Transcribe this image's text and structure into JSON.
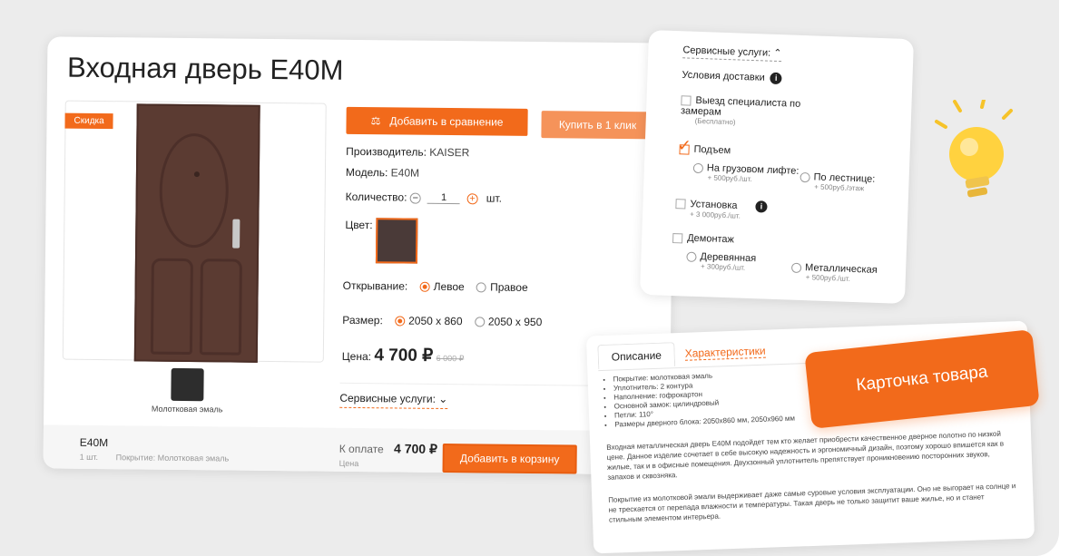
{
  "product": {
    "title": "Входная дверь E40M",
    "sale_badge": "Скидка",
    "swatch_label": "Молотковая эмаль",
    "compare_button": "Добавить в сравнение",
    "buy_one_click": "Купить в 1 клик",
    "manufacturer_label": "Производитель:",
    "manufacturer": "KAISER",
    "model_label": "Модель:",
    "model": "E40M",
    "quantity_label": "Количество:",
    "quantity_value": "1",
    "quantity_unit": "шт.",
    "color_label": "Цвет:",
    "opening_label": "Открывание:",
    "opening_options": [
      "Левое",
      "Правое"
    ],
    "size_label": "Размер:",
    "size_options": [
      "2050 x 860",
      "2050 x 950"
    ],
    "price_label": "Цена:",
    "price": "4 700 ₽",
    "old_price": "6 000 ₽",
    "services_toggle": "Сервисные услуги:"
  },
  "bottom_bar": {
    "model": "E40M",
    "qty": "1 шт.",
    "coating": "Покрытие: Молотковая эмаль",
    "to_pay_label": "К оплате",
    "total": "4 700 ₽",
    "price_caption": "Цена",
    "add_to_cart": "Добавить в корзину"
  },
  "services": {
    "header": "Сервисные услуги:",
    "delivery_label": "Условия доставки",
    "visit": {
      "label": "Выезд специалиста по замерам",
      "note": "(Бесплатно)"
    },
    "lift": {
      "label": "Подъем",
      "freight": "На грузовом лифте:",
      "freight_price": "+ 500руб./шт.",
      "stairs": "По лестнице:",
      "stairs_price": "+ 500руб./этаж"
    },
    "install": {
      "label": "Установка",
      "price": "+ 3 000руб./шт."
    },
    "dismantle": {
      "label": "Демонтаж",
      "wood": "Деревянная",
      "wood_price": "+ 300руб./шт.",
      "metal": "Металлическая",
      "metal_price": "+ 500руб./шт."
    }
  },
  "description": {
    "tab_description": "Описание",
    "tab_specs": "Характеристики",
    "bullets": [
      "Покрытие: молотковая эмаль",
      "Уплотнитель: 2 контура",
      "Наполнение: гофрокартон",
      "Основной замок: цилиндровый",
      "Петли: 110°",
      "Размеры дверного блока: 2050x860 мм, 2050x960 мм"
    ],
    "paragraph1": "Входная металлическая дверь E40M подойдет тем кто желает приобрести качественное дверное полотно по низкой цене. Данное изделие сочетает в себе высокую надежность и эргономичный дизайн, поэтому хорошо впишется как в жилые, так и в офисные помещения. Двухзонный уплотнитель препятствует проникновению посторонних звуков, запахов и сквозняка.",
    "paragraph2": "Покрытие из молотковой эмали выдерживает даже самые суровые условия эксплуатации. Оно не выгорает на солнце и не трескается от перепада влажности и температуры. Такая дверь не только защитит ваше жилье, но и станет стильным элементом интерьера."
  },
  "badge": {
    "text": "Карточка товара"
  },
  "colors": {
    "accent": "#f26a1b",
    "door": "#5b3b32"
  }
}
